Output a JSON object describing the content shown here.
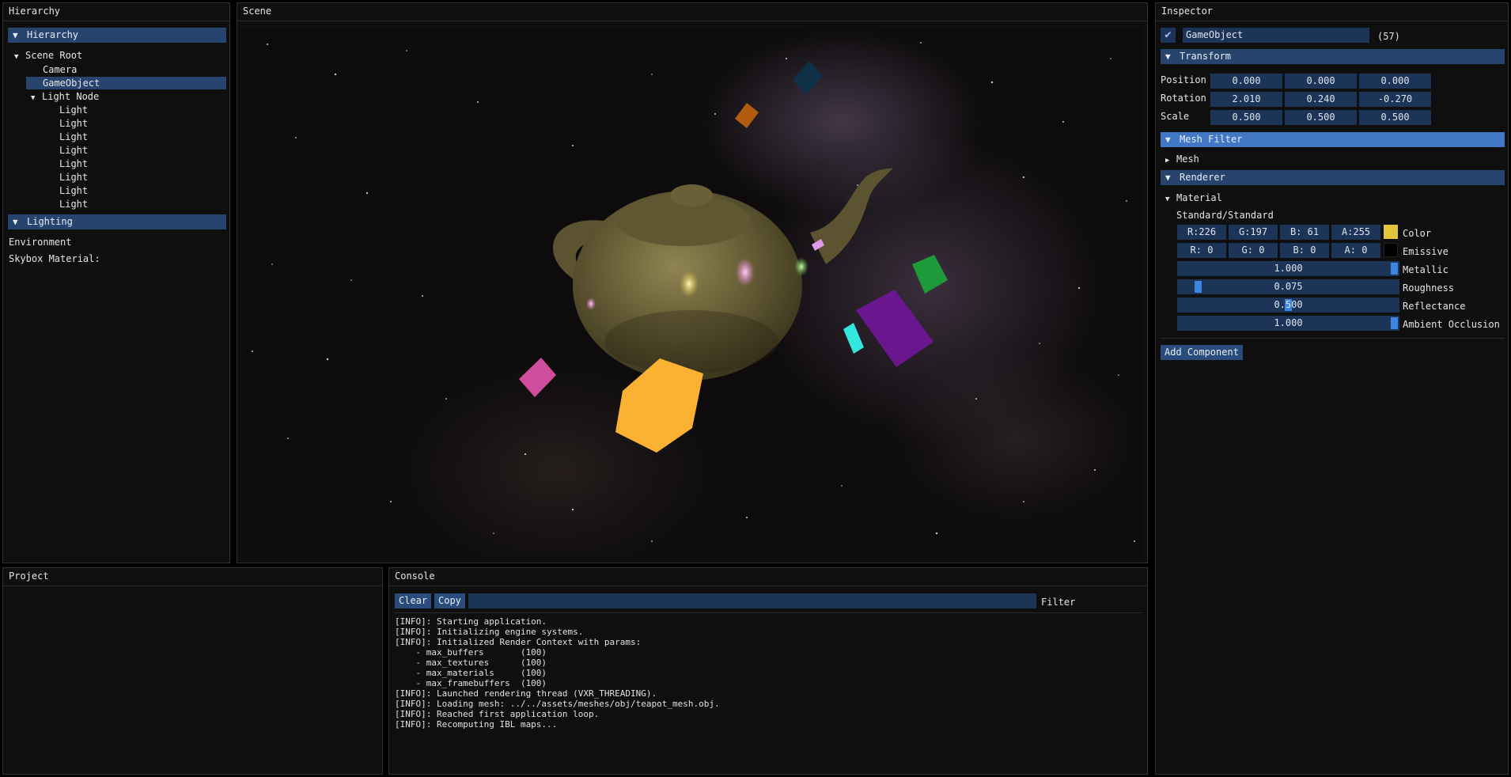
{
  "hierarchy_panel": {
    "title": "Hierarchy",
    "header": "Hierarchy",
    "scene_root": "Scene Root",
    "camera": "Camera",
    "game_object": "GameObject",
    "light_node": "Light Node",
    "lights": [
      "Light",
      "Light",
      "Light",
      "Light",
      "Light",
      "Light",
      "Light",
      "Light"
    ],
    "lighting_header": "Lighting",
    "environment": "Environment",
    "skybox_material": "Skybox Material:"
  },
  "scene_panel": {
    "title": "Scene"
  },
  "project_panel": {
    "title": "Project"
  },
  "console_panel": {
    "title": "Console",
    "clear_label": "Clear",
    "copy_label": "Copy",
    "filter_value": "",
    "filter_label": "Filter",
    "lines": [
      "[INFO]: Starting application.",
      "[INFO]: Initializing engine systems.",
      "[INFO]: Initialized Render Context with params:",
      "    - max_buffers       (100)",
      "    - max_textures      (100)",
      "    - max_materials     (100)",
      "    - max_framebuffers  (100)",
      "[INFO]: Launched rendering thread (VXR_THREADING).",
      "[INFO]: Loading mesh: ../../assets/meshes/obj/teapot_mesh.obj.",
      "[INFO]: Reached first application loop.",
      "[INFO]: Recomputing IBL maps..."
    ]
  },
  "inspector": {
    "title": "Inspector",
    "object_name": "GameObject",
    "object_id": "(57)",
    "enabled": true,
    "transform": {
      "header": "Transform",
      "position_label": "Position",
      "position": [
        "0.000",
        "0.000",
        "0.000"
      ],
      "rotation_label": "Rotation",
      "rotation": [
        "2.010",
        "0.240",
        "-0.270"
      ],
      "scale_label": "Scale",
      "scale": [
        "0.500",
        "0.500",
        "0.500"
      ]
    },
    "mesh_filter": {
      "header": "Mesh Filter",
      "mesh_label": "Mesh"
    },
    "renderer": {
      "header": "Renderer",
      "material_label": "Material",
      "shader": "Standard/Standard",
      "color": {
        "r": "R:226",
        "g": "G:197",
        "b": "B: 61",
        "a": "A:255",
        "label": "Color",
        "hex": "#e2c53d"
      },
      "emissive": {
        "r": "R:  0",
        "g": "G:  0",
        "b": "B:  0",
        "a": "A:  0",
        "label": "Emissive",
        "hex": "#000000"
      },
      "metallic": {
        "value": "1.000",
        "fraction": 1.0,
        "label": "Metallic"
      },
      "roughness": {
        "value": "0.075",
        "fraction": 0.075,
        "label": "Roughness"
      },
      "reflectance": {
        "value": "0.500",
        "fraction": 0.5,
        "label": "Reflectance"
      },
      "ambient_occlusion": {
        "value": "1.000",
        "fraction": 1.0,
        "label": "Ambient Occlusion"
      }
    },
    "add_component_label": "Add Component"
  },
  "colors": {
    "header_blue": "#27446e",
    "header_blue_bright": "#4177c4",
    "field_blue": "#1c3457",
    "slider_grab": "#3d85e0",
    "panel_bg": "#0f0f0f"
  }
}
